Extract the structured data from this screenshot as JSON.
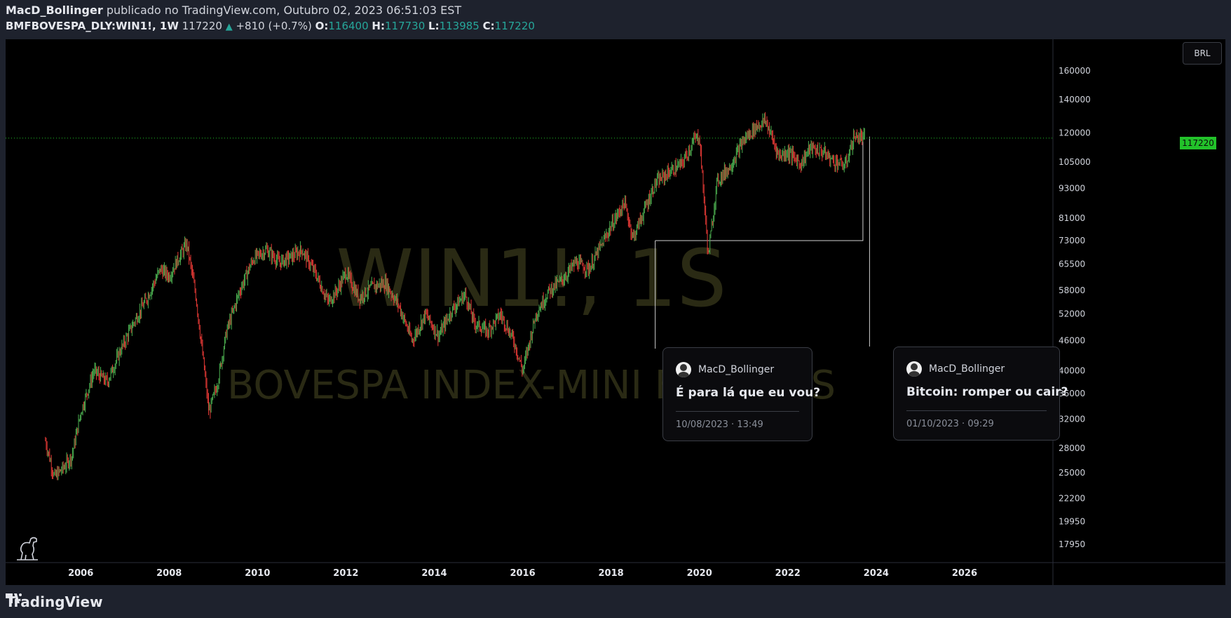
{
  "header": {
    "author": "MacD_Bollinger",
    "published_text": "publicado no TradingView.com, Outubro 02, 2023 06:51:03 EST",
    "symbol": "BMFBOVESPA_DLY:WIN1!, 1W",
    "last": "117220",
    "change_arrow": "▲",
    "change": "+810 (+0.7%)",
    "o_label": "O:",
    "o_value": "116400",
    "h_label": "H:",
    "h_value": "117730",
    "l_label": "L:",
    "l_value": "113985",
    "c_label": "C:",
    "c_value": "117220"
  },
  "watermark": {
    "symbol": "WIN1!, 1S",
    "name": "BOVESPA INDEX-MINI FUTURES"
  },
  "currency_button": "BRL",
  "last_price_tag": "117220",
  "ideas": [
    {
      "user": "MacD_Bollinger",
      "title": "É para lá que eu vou?",
      "date": "10/08/2023 · 13:49"
    },
    {
      "user": "MacD_Bollinger",
      "title": "Bitcoin: romper ou cair?",
      "date": "01/10/2023 · 09:29"
    }
  ],
  "footer": {
    "brand": "TradingView"
  },
  "colors": {
    "up": "#26a69a",
    "candle_up": "#4caf50",
    "candle_down": "#e53935",
    "last_price": "#22c22a",
    "background": "#000000"
  },
  "chart_data": {
    "type": "line",
    "scale": "log",
    "x_ticks": [
      "2006",
      "2008",
      "2010",
      "2012",
      "2014",
      "2016",
      "2018",
      "2020",
      "2022",
      "2024",
      "2026"
    ],
    "y_ticks": [
      160000,
      140000,
      120000,
      105000,
      93000,
      81000,
      73000,
      65500,
      58000,
      52000,
      46000,
      40000,
      36000,
      32000,
      28000,
      25000,
      22200,
      19950,
      17950
    ],
    "ylim": [
      16500,
      185000
    ],
    "xlim": [
      2004.3,
      2028.0
    ],
    "last_price": 117220,
    "series": [
      {
        "x": [
          2005.2,
          2005.4,
          2005.6,
          2005.8,
          2006.0,
          2006.3,
          2006.6,
          2006.9,
          2007.2,
          2007.5,
          2007.8,
          2008.0,
          2008.2,
          2008.4,
          2008.6,
          2008.8,
          2008.9,
          2009.1,
          2009.3,
          2009.6,
          2009.9,
          2010.2,
          2010.5,
          2010.8,
          2011.0,
          2011.3,
          2011.6,
          2011.8,
          2012.0,
          2012.3,
          2012.6,
          2012.9,
          2013.2,
          2013.5,
          2013.8,
          2014.1,
          2014.4,
          2014.7,
          2014.9,
          2015.2,
          2015.5,
          2015.8,
          2016.0,
          2016.3,
          2016.6,
          2016.9,
          2017.2,
          2017.5,
          2017.8,
          2018.0,
          2018.3,
          2018.5,
          2018.8,
          2019.0,
          2019.3,
          2019.6,
          2019.9,
          2020.0,
          2020.2,
          2020.4,
          2020.7,
          2021.0,
          2021.3,
          2021.5,
          2021.8,
          2022.0,
          2022.3,
          2022.5,
          2022.8,
          2023.0,
          2023.3,
          2023.5,
          2023.75
        ],
        "values": [
          29000,
          24500,
          25500,
          27000,
          33000,
          40000,
          38000,
          44000,
          50000,
          56000,
          64000,
          62000,
          67000,
          72000,
          57000,
          40000,
          33000,
          38000,
          48000,
          58000,
          67000,
          70000,
          66000,
          68000,
          70000,
          63000,
          55000,
          58000,
          63000,
          56000,
          59000,
          60000,
          54000,
          46000,
          52000,
          47000,
          53000,
          57000,
          50000,
          48000,
          52000,
          46000,
          40000,
          52000,
          58000,
          61000,
          66000,
          64000,
          72000,
          78000,
          87000,
          74000,
          86000,
          95000,
          100000,
          104000,
          117000,
          118000,
          68000,
          96000,
          103000,
          116000,
          124000,
          127000,
          108000,
          110000,
          104000,
          112000,
          110000,
          106000,
          103000,
          118000,
          117220
        ]
      }
    ]
  }
}
